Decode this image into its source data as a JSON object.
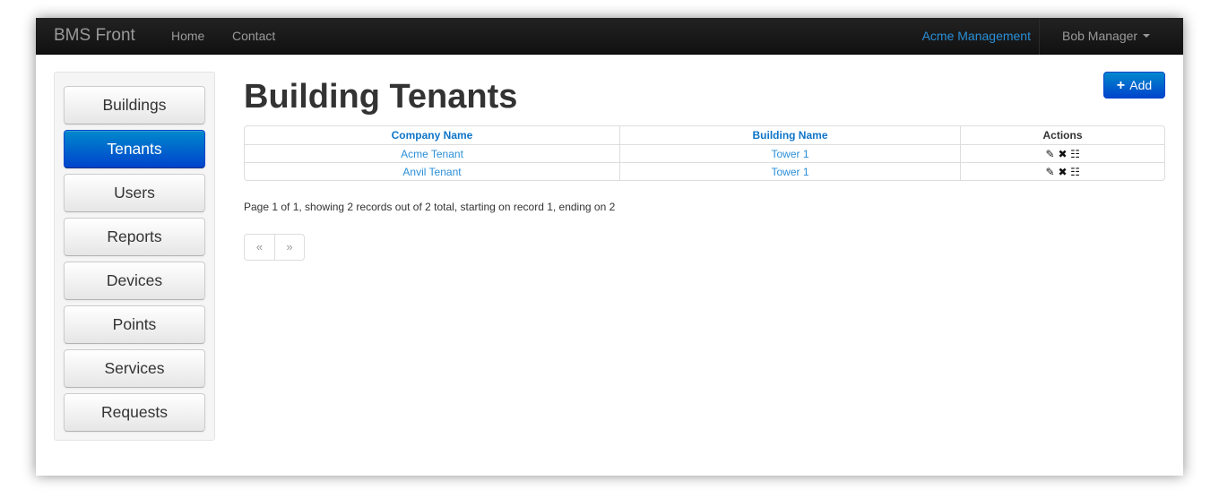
{
  "navbar": {
    "brand": "BMS Front",
    "links": [
      "Home",
      "Contact"
    ],
    "organization": "Acme Management",
    "user": "Bob Manager"
  },
  "sidebar": {
    "items": [
      {
        "label": "Buildings",
        "active": false
      },
      {
        "label": "Tenants",
        "active": true
      },
      {
        "label": "Users",
        "active": false
      },
      {
        "label": "Reports",
        "active": false
      },
      {
        "label": "Devices",
        "active": false
      },
      {
        "label": "Points",
        "active": false
      },
      {
        "label": "Services",
        "active": false
      },
      {
        "label": "Requests",
        "active": false
      }
    ]
  },
  "main": {
    "title": "Building Tenants",
    "add_button": "Add",
    "table": {
      "headers": [
        "Company Name",
        "Building Name",
        "Actions"
      ],
      "rows": [
        {
          "company": "Acme Tenant",
          "building": "Tower 1"
        },
        {
          "company": "Anvil Tenant",
          "building": "Tower 1"
        }
      ]
    },
    "pagination_info": "Page 1 of 1, showing 2 records out of 2 total, starting on record 1, ending on 2",
    "pager": {
      "prev": "«",
      "next": "»"
    }
  },
  "icons": {
    "edit": "edit-icon",
    "delete": "delete-icon",
    "view": "list-icon",
    "add": "plus-icon"
  },
  "colors": {
    "navbar": "#1b1b1b",
    "accent": "#0055cc",
    "link": "#2a8fd8"
  }
}
